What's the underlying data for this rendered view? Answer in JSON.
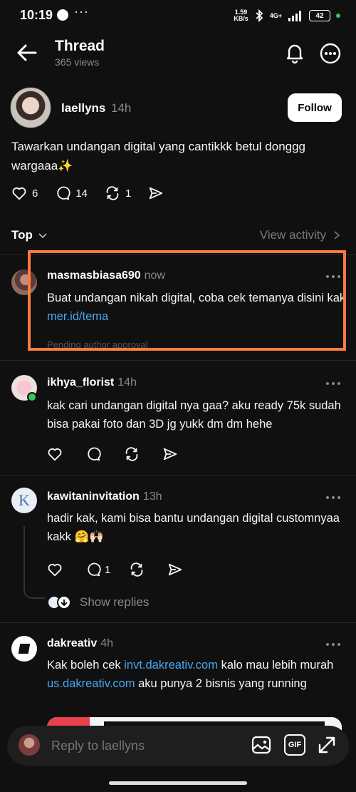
{
  "status_bar": {
    "time": "10:19",
    "net_speed_value": "1.59",
    "net_speed_unit": "KB/s",
    "network": "4G+",
    "battery": "42"
  },
  "header": {
    "title": "Thread",
    "views": "365 views"
  },
  "post": {
    "username": "laellyns",
    "time": "14h",
    "follow_label": "Follow",
    "text": "Tawarkan undangan digital yang cantikkk betul donggg wargaaa✨",
    "likes": "6",
    "comments": "14",
    "reposts": "1"
  },
  "sort": {
    "label": "Top",
    "activity_label": "View activity"
  },
  "replies": [
    {
      "username": "masmasbiasa690",
      "time": "now",
      "text_prefix": "Buat undangan nikah digital, coba cek temanya disini kak ",
      "link": "mer.id/tema",
      "pending": "Pending author approval"
    },
    {
      "username": "ikhya_florist",
      "time": "14h",
      "text": "kak cari undangan digital nya gaa? aku ready 75k sudah bisa pakai foto dan 3D jg yukk dm dm hehe"
    },
    {
      "username": "kawitaninvitation",
      "time": "13h",
      "avatar_letter": "K",
      "text": "hadir kak, kami bisa bantu undangan digital customnyaa kakk 🤗🙌🏻",
      "comments": "1",
      "show_replies_label": "Show replies"
    },
    {
      "username": "dakreativ",
      "time": "4h",
      "text_1": "Kak boleh cek ",
      "link_1": "invt.dakreativ.com",
      "text_2": " kalo mau lebih murah ",
      "link_2": "us.dakreativ.com",
      "text_3": " aku punya 2 bisnis yang running"
    }
  ],
  "reply_bar": {
    "placeholder": "Reply to laellyns",
    "gif_label": "GIF"
  },
  "colors": {
    "background": "#101010",
    "link": "#4aa8f0",
    "highlight": "#ff7a3d",
    "online": "#34c759"
  },
  "icons": [
    "back-arrow-icon",
    "bell-icon",
    "more-icon",
    "heart-icon",
    "comment-icon",
    "repost-icon",
    "share-icon",
    "chevron-down-icon",
    "chevron-right-icon",
    "image-icon",
    "gif-icon",
    "expand-icon"
  ]
}
